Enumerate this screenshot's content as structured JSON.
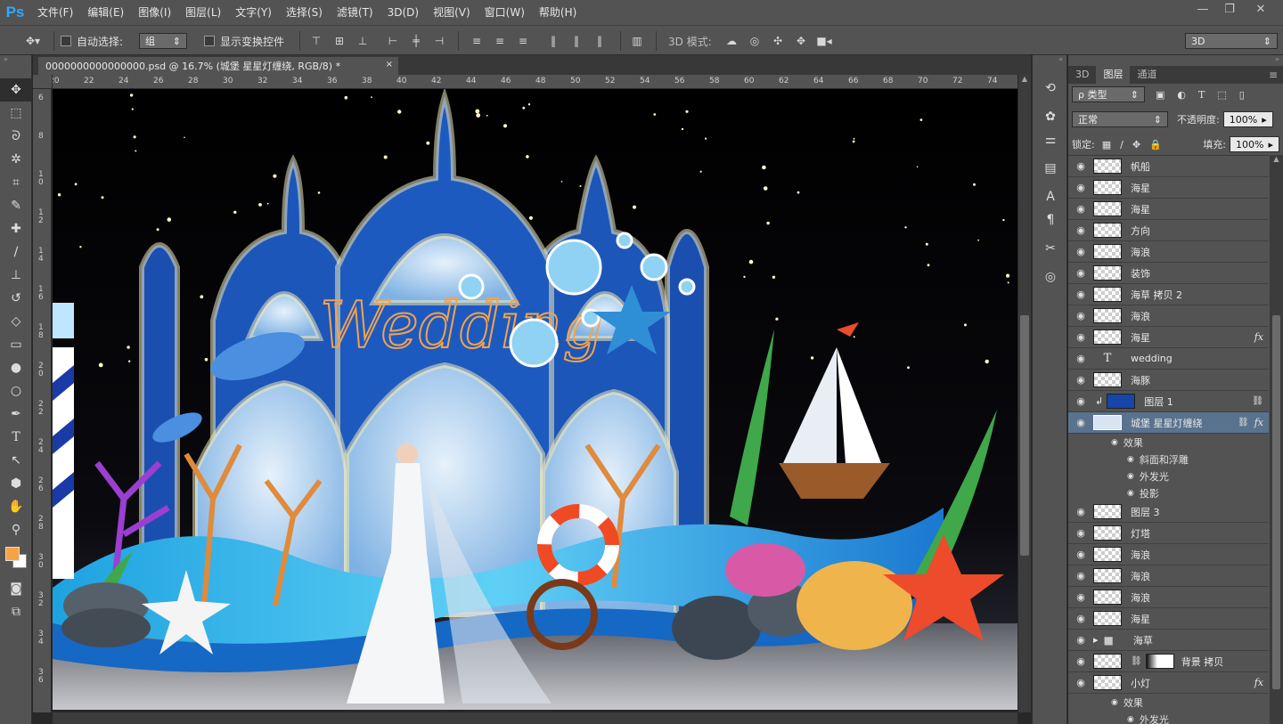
{
  "menu": {
    "logo": "Ps",
    "items": [
      "文件(F)",
      "编辑(E)",
      "图像(I)",
      "图层(L)",
      "文字(Y)",
      "选择(S)",
      "滤镜(T)",
      "3D(D)",
      "视图(V)",
      "窗口(W)",
      "帮助(H)"
    ]
  },
  "options": {
    "auto_select_label": "自动选择:",
    "auto_select_value": "组",
    "show_transform_label": "显示变换控件",
    "mode3d_label": "3D 模式:",
    "workspace": "3D"
  },
  "document": {
    "tab_title": "0000000000000000.psd @ 16.7% (城堡  星星灯缠绕, RGB/8) *",
    "close": "×",
    "ruler_h": [
      "20",
      "22",
      "24",
      "26",
      "28",
      "30",
      "32",
      "34",
      "36",
      "38",
      "40",
      "42",
      "44",
      "46",
      "48",
      "50",
      "52",
      "54",
      "56",
      "58",
      "60",
      "62",
      "64",
      "66",
      "68",
      "70",
      "72",
      "74"
    ],
    "ruler_v": [
      "6",
      "8",
      "1\n0",
      "1\n2",
      "1\n4",
      "1\n6",
      "1\n8",
      "2\n0",
      "2\n2",
      "2\n4",
      "2\n6",
      "2\n8",
      "3\n0",
      "3\n2",
      "3\n4",
      "3\n6"
    ],
    "wedding_text": "Wedding"
  },
  "panel": {
    "tabs": [
      "3D",
      "图层",
      "通道"
    ],
    "filter_label": "ρ 类型",
    "blend_mode": "正常",
    "opacity_label": "不透明度:",
    "opacity_value": "100%",
    "lock_label": "锁定:",
    "fill_label": "填充:",
    "fill_value": "100%"
  },
  "layers": [
    {
      "name": "帆船",
      "thumb": "checker"
    },
    {
      "name": "海星",
      "thumb": "checker"
    },
    {
      "name": "海星",
      "thumb": "checker"
    },
    {
      "name": "方向",
      "thumb": "checker"
    },
    {
      "name": "海浪",
      "thumb": "checker"
    },
    {
      "name": "装饰",
      "thumb": "checker"
    },
    {
      "name": "海草 拷贝 2",
      "thumb": "checker"
    },
    {
      "name": "海浪",
      "thumb": "checker"
    },
    {
      "name": "海星",
      "thumb": "checker",
      "fx": "fx"
    },
    {
      "name": "wedding",
      "thumb": "text"
    },
    {
      "name": "海豚",
      "thumb": "checker"
    },
    {
      "name": "图层 1",
      "thumb": "blue",
      "clip": true
    },
    {
      "name": "城堡  星星灯缠绕",
      "thumb": "castle",
      "selected": true,
      "fx": "fx"
    },
    {
      "name": "效果",
      "sub": 1
    },
    {
      "name": "斜面和浮雕",
      "sub": 2
    },
    {
      "name": "外发光",
      "sub": 2
    },
    {
      "name": "投影",
      "sub": 2
    },
    {
      "name": "图层 3",
      "thumb": "checker"
    },
    {
      "name": "灯塔",
      "thumb": "checker"
    },
    {
      "name": "海浪",
      "thumb": "checker"
    },
    {
      "name": "海浪",
      "thumb": "checker"
    },
    {
      "name": "海浪",
      "thumb": "checker"
    },
    {
      "name": "海星",
      "thumb": "checker"
    },
    {
      "name": "海草",
      "thumb": "folder"
    },
    {
      "name": "背景 拷贝",
      "thumb": "mask"
    },
    {
      "name": "小灯",
      "thumb": "checker",
      "fx": "fx"
    },
    {
      "name": "效果",
      "sub": 1
    },
    {
      "name": "外发光",
      "sub": 2
    }
  ]
}
